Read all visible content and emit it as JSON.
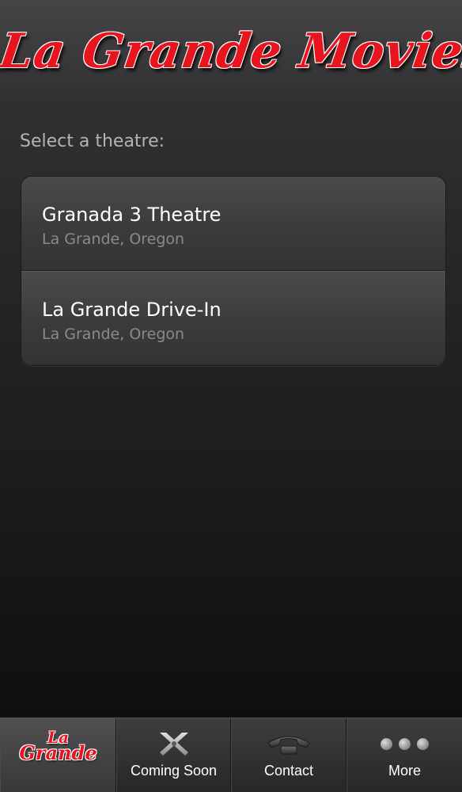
{
  "app": {
    "logo_text": "La Grande Movies"
  },
  "main": {
    "prompt": "Select a theatre:",
    "theatres": [
      {
        "name": "Granada 3 Theatre",
        "location": "La Grande, Oregon"
      },
      {
        "name": "La Grande Drive-In",
        "location": "La Grande, Oregon"
      }
    ]
  },
  "tabbar": {
    "home_logo_line1": "La",
    "home_logo_line2": "Grande",
    "tabs": [
      {
        "label": "Coming Soon",
        "icon": "scissors-icon"
      },
      {
        "label": "Contact",
        "icon": "phone-icon"
      },
      {
        "label": "More",
        "icon": "more-dots-icon"
      }
    ]
  },
  "colors": {
    "brand_red": "#e8141e",
    "background": "#1c1c1e"
  }
}
